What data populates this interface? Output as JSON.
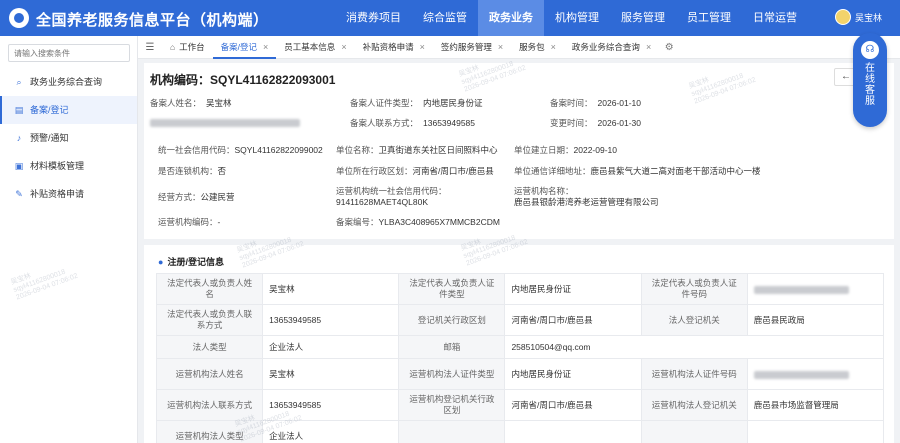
{
  "header": {
    "app_title": "全国养老服务信息平台（机构端）",
    "nav": [
      "消费券项目",
      "综合监管",
      "政务业务",
      "机构管理",
      "服务管理",
      "员工管理",
      "日常运营"
    ],
    "active_nav": "政务业务",
    "username": "吴宝林"
  },
  "sidebar": {
    "search_placeholder": "请输入搜索条件",
    "items": [
      {
        "label": "政务业务综合查询",
        "icon": "search-icon"
      },
      {
        "label": "备案/登记",
        "icon": "document-icon",
        "active": true
      },
      {
        "label": "预警/通知",
        "icon": "bell-icon"
      },
      {
        "label": "材料模板管理",
        "icon": "folder-icon"
      },
      {
        "label": "补贴资格申请",
        "icon": "apply-icon"
      }
    ]
  },
  "tabs": [
    {
      "label": "工作台"
    },
    {
      "label": "备案/登记",
      "active": true
    },
    {
      "label": "员工基本信息"
    },
    {
      "label": "补贴资格申请"
    },
    {
      "label": "签约服务管理"
    },
    {
      "label": "服务包"
    },
    {
      "label": "政务业务综合查询"
    }
  ],
  "record": {
    "org_code": "机构编码：SQYL41162822093001",
    "filer_name_label": "备案人姓名：",
    "filer_name": "吴宝林",
    "id_type_label": "备案人证件类型：",
    "id_type": "内地居民身份证",
    "filing_time_label": "备案时间：",
    "filing_time": "2026-01-10",
    "phone_label": "备案人联系方式：",
    "phone": "13653949585",
    "change_time_label": "变更时间：",
    "change_time": "2026-01-30"
  },
  "info": {
    "credit_code_label": "统一社会信用代码：",
    "credit_code": "SQYL41162822099002",
    "unit_name_label": "单位名称：",
    "unit_name": "卫真街道东关社区日间照料中心",
    "founded_label": "单位建立日期：",
    "founded": "2022-09-10",
    "chain_label": "是否连锁机构：",
    "chain": "否",
    "region_label": "单位所在行政区划：",
    "region": "河南省/周口市/鹿邑县",
    "address_label": "单位通信详细地址：",
    "address": "鹿邑县紫气大道二高对面老干部活动中心一楼",
    "biz_mode_label": "经营方式：",
    "biz_mode": "公建民营",
    "op_credit_label": "运营机构统一社会信用代码：",
    "op_credit": "91411628MAET4QL80K",
    "op_name_label": "运营机构名称：",
    "op_name": "鹿邑县银龄港湾养老运营管理有限公司",
    "op_code_label": "运营机构编码：",
    "op_code": "-",
    "filing_no_label": "备案编号：",
    "filing_no": "YLBA3C408965X7MMCB2CDM"
  },
  "registration": {
    "title": "注册/登记信息",
    "rows": [
      [
        {
          "k": "法定代表人或负责人姓名",
          "v": "吴宝林"
        },
        {
          "k": "法定代表人或负责人证件类型",
          "v": "内地居民身份证"
        },
        {
          "k": "法定代表人或负责人证件号码",
          "v": "",
          "blurred": true
        }
      ],
      [
        {
          "k": "法定代表人或负责人联系方式",
          "v": "13653949585"
        },
        {
          "k": "登记机关行政区划",
          "v": "河南省/周口市/鹿邑县"
        },
        {
          "k": "法人登记机关",
          "v": "鹿邑县民政局"
        }
      ],
      [
        {
          "k": "法人类型",
          "v": "企业法人"
        },
        {
          "k": "邮箱",
          "v": "258510504@qq.com"
        },
        {
          "k": "",
          "v": ""
        }
      ],
      [
        {
          "k": "运营机构法人姓名",
          "v": "吴宝林"
        },
        {
          "k": "运营机构法人证件类型",
          "v": "内地居民身份证"
        },
        {
          "k": "运营机构法人证件号码",
          "v": "",
          "blurred": true
        }
      ],
      [
        {
          "k": "运营机构法人联系方式",
          "v": "13653949585"
        },
        {
          "k": "运营机构登记机关行政区划",
          "v": "河南省/周口市/鹿邑县"
        },
        {
          "k": "运营机构法人登记机关",
          "v": "鹿邑县市场监督管理局"
        }
      ],
      [
        {
          "k": "运营机构法人类型",
          "v": "企业法人"
        },
        {
          "k": "",
          "v": ""
        },
        {
          "k": "",
          "v": ""
        }
      ]
    ]
  },
  "service": {
    "label": "在线客服"
  },
  "watermark": {
    "name": "吴宝林",
    "account": "sqyl41162800018",
    "time": "2026-09-04 07:06:02"
  }
}
